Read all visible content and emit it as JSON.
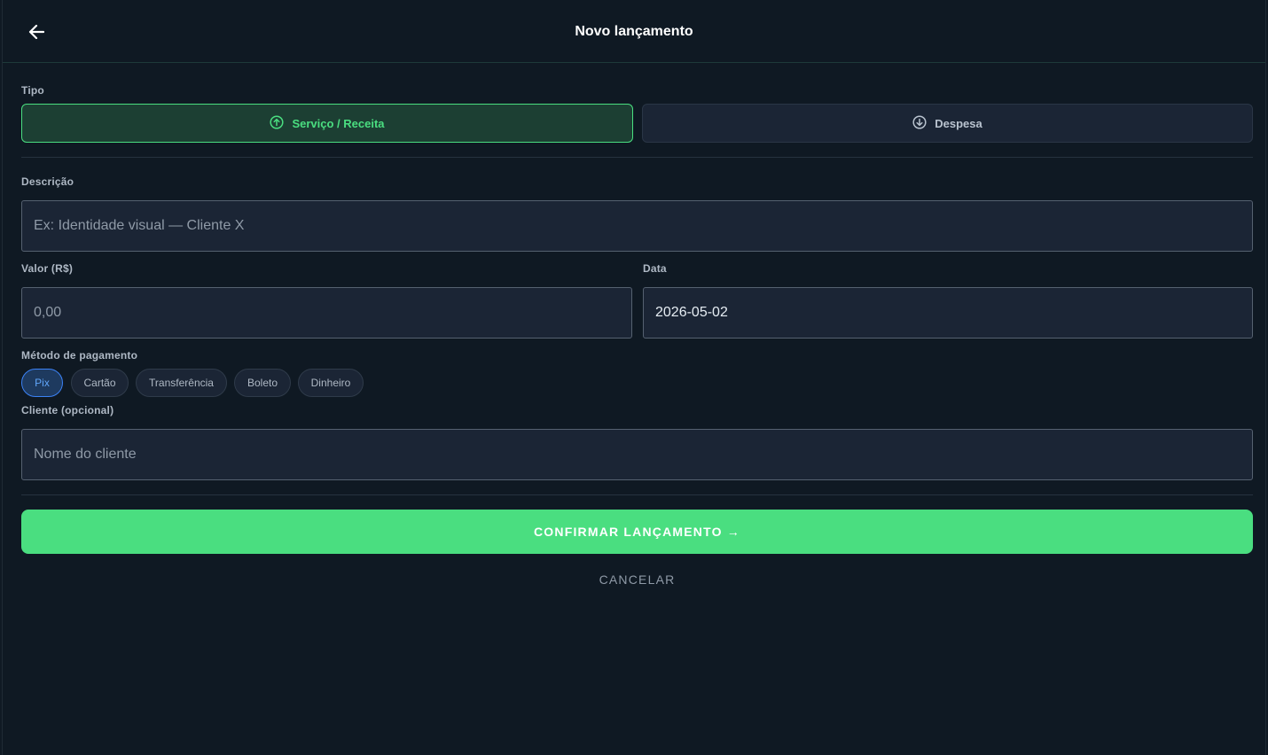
{
  "header": {
    "title": "Novo lançamento",
    "back_icon": "arrow-left-icon"
  },
  "tipo": {
    "label": "Tipo",
    "options": [
      {
        "label": "Serviço / Receita",
        "icon": "arrow-up-circle-icon",
        "selected": true
      },
      {
        "label": "Despesa",
        "icon": "arrow-down-circle-icon",
        "selected": false
      }
    ]
  },
  "descricao": {
    "label": "Descrição",
    "placeholder": "Ex: Identidade visual — Cliente X",
    "value": ""
  },
  "valor": {
    "label": "Valor (R$)",
    "placeholder": "0,00",
    "value": ""
  },
  "data": {
    "label": "Data",
    "value": "2026-05-02"
  },
  "metodo": {
    "label": "Método de pagamento",
    "options": [
      {
        "label": "Pix",
        "selected": true
      },
      {
        "label": "Cartão",
        "selected": false
      },
      {
        "label": "Transferência",
        "selected": false
      },
      {
        "label": "Boleto",
        "selected": false
      },
      {
        "label": "Dinheiro",
        "selected": false
      }
    ]
  },
  "cliente": {
    "label": "Cliente (opcional)",
    "placeholder": "Nome do cliente",
    "value": ""
  },
  "actions": {
    "confirm_label": "CONFIRMAR LANÇAMENTO →",
    "cancel_label": "CANCELAR"
  },
  "colors": {
    "background": "#0f1923",
    "accent_green": "#4ade80",
    "accent_blue": "#3b82f6",
    "field_bg": "#1b2535"
  }
}
